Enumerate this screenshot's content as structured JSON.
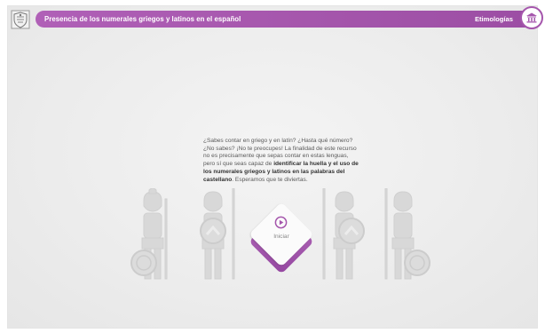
{
  "header": {
    "title": "Presencia de los numerales griegos y latinos en el español",
    "subject": "Etimologías",
    "logo_icon": "university-crest-icon",
    "home_icon": "home-temple-icon"
  },
  "intro": {
    "part1": "¿Sabes contar en griego y en latín? ¿Hasta qué número? ¿No sabes? ¡No te preocupes! La finalidad de este recurso no es precisamente que sepas contar en estas lenguas, pero sí que seas capaz de ",
    "bold": "identificar la huella y el uso de los numerales griegos y latinos en las palabras del castellano",
    "part2": ". Esperamos que te diviertas."
  },
  "start": {
    "label": "Iniciar",
    "icon": "play-circle-icon"
  },
  "colors": {
    "accent": "#a556ac",
    "text": "#5a5a5a",
    "warrior": "#d6d6d6"
  }
}
